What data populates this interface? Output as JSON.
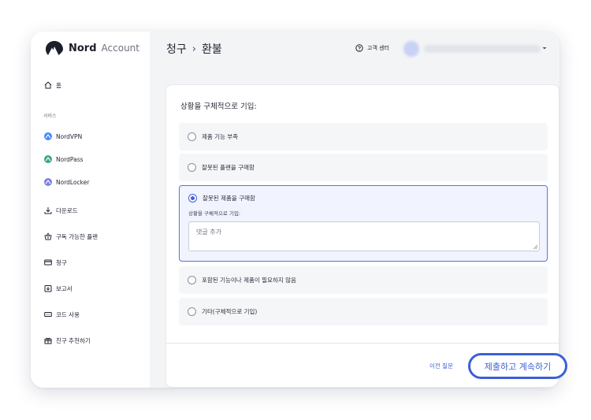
{
  "brand": {
    "name": "Nord",
    "product": "Account"
  },
  "sidebar": {
    "home_label": "홈",
    "services_label": "서비스",
    "services": [
      {
        "label": "NordVPN",
        "color": "#4687ff"
      },
      {
        "label": "NordPass",
        "color": "#3fa38e"
      },
      {
        "label": "NordLocker",
        "color": "#7d7fe6"
      }
    ],
    "items": [
      {
        "label": "다운로드",
        "icon": "download-icon"
      },
      {
        "label": "구독 가능한 플랜",
        "icon": "basket-icon"
      },
      {
        "label": "청구",
        "icon": "card-icon"
      },
      {
        "label": "보고서",
        "icon": "report-icon"
      },
      {
        "label": "코드 사용",
        "icon": "ticket-icon"
      },
      {
        "label": "친구 추천하기",
        "icon": "gift-icon"
      }
    ]
  },
  "header": {
    "breadcrumb_parent": "청구",
    "breadcrumb_sep": "›",
    "breadcrumb_current": "환불",
    "help_label": "고객 센터"
  },
  "form": {
    "heading": "상황을 구체적으로 기입:",
    "options": [
      {
        "label": "제품 기능 부족",
        "checked": false
      },
      {
        "label": "잘못된 플랜을 구매함",
        "checked": false
      },
      {
        "label": "잘못된 제품을 구매함",
        "checked": true
      },
      {
        "label": "포함된 기능이나 제품이 필요하지 않음",
        "checked": false
      },
      {
        "label": "기타(구체적으로 기입)",
        "checked": false
      }
    ],
    "detail_label": "상황을 구체적으로 기입:",
    "comment_placeholder": "댓글 추가",
    "prev_label": "이전 질문",
    "submit_label": "제출하고 계속하기"
  },
  "colors": {
    "accent": "#3e5fd7",
    "background": "#f3f4f6"
  }
}
